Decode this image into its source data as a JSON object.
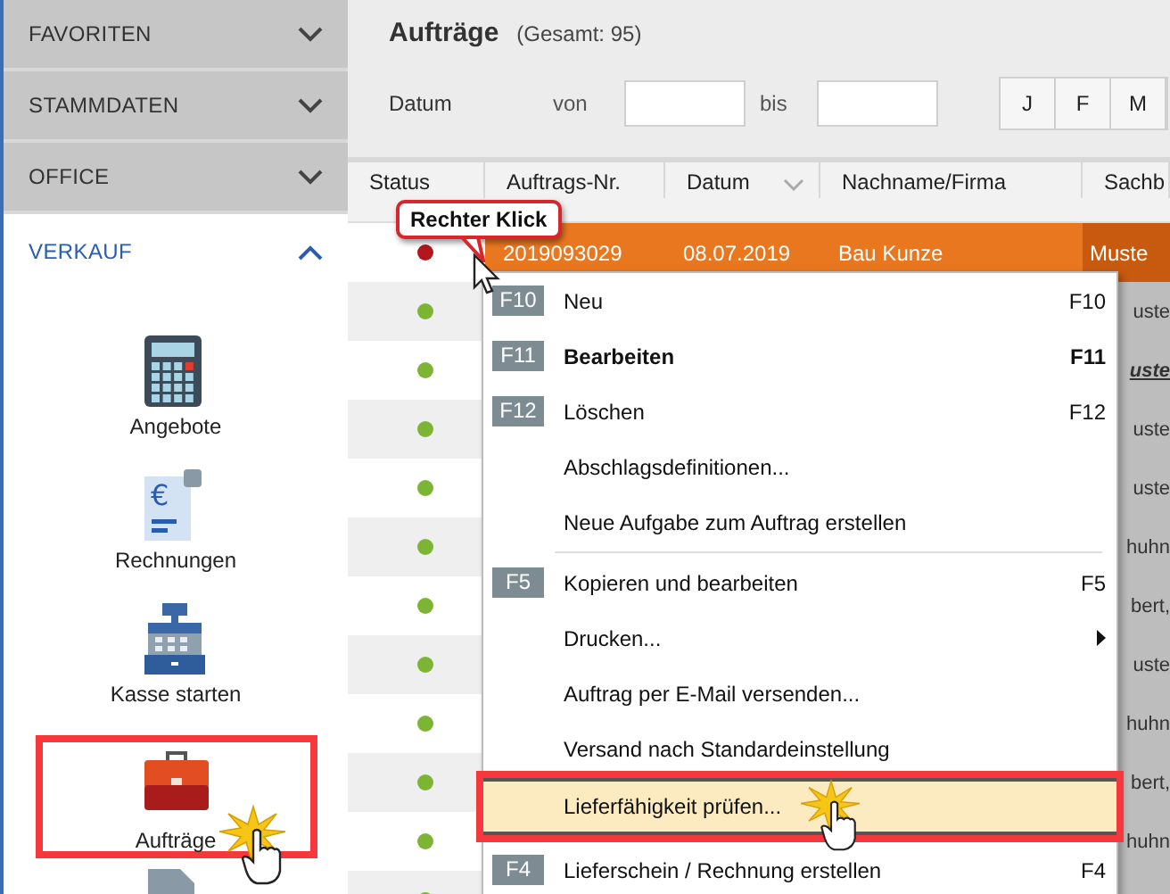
{
  "sidebar": {
    "sections": [
      {
        "label": "FAVORITEN",
        "expanded": false
      },
      {
        "label": "STAMMDATEN",
        "expanded": false
      },
      {
        "label": "OFFICE",
        "expanded": false
      },
      {
        "label": "VERKAUF",
        "expanded": true,
        "items": [
          {
            "kind": "calculator",
            "label": "Angebote",
            "highlighted": false
          },
          {
            "kind": "invoice",
            "glyph": "€",
            "label": "Rechnungen",
            "highlighted": false
          },
          {
            "kind": "register",
            "label": "Kasse starten",
            "highlighted": false
          },
          {
            "kind": "briefcase",
            "label": "Aufträge",
            "highlighted": true
          },
          {
            "kind": "document"
          }
        ]
      }
    ]
  },
  "main": {
    "title": "Aufträge",
    "total": "(Gesamt: 95)",
    "filter": {
      "label": "Datum",
      "from_label": "von",
      "to_label": "bis",
      "months": [
        "J",
        "F",
        "M"
      ]
    }
  },
  "table": {
    "columns": [
      {
        "label": "Status",
        "sorted": false
      },
      {
        "label": "Auftrags-Nr.",
        "sorted": false
      },
      {
        "label": "Datum",
        "sorted": true
      },
      {
        "label": "Nachname/Firma",
        "sorted": false
      },
      {
        "label": "Sachb",
        "sorted": false
      }
    ],
    "rows": [
      {
        "color": "#b3161c",
        "order_no": "2019093029",
        "date": "08.07.2019",
        "name": "Bau Kunze",
        "column_5": "Muste",
        "selected": true,
        "emphasized": false
      },
      {
        "color": "#7cb434",
        "column_5": "uste",
        "selected": false,
        "emphasized": false
      },
      {
        "color": "#7cb434",
        "column_5": "uste",
        "selected": false,
        "emphasized": true
      },
      {
        "color": "#7cb434",
        "column_5": "uste",
        "selected": false,
        "emphasized": false
      },
      {
        "color": "#7cb434",
        "column_5": "uste",
        "selected": false,
        "emphasized": false
      },
      {
        "color": "#7cb434",
        "column_5": "huhn",
        "selected": false,
        "emphasized": false
      },
      {
        "color": "#7cb434",
        "column_5": "bert,",
        "selected": false,
        "emphasized": false
      },
      {
        "color": "#7cb434",
        "column_5": "uste",
        "selected": false,
        "emphasized": false
      },
      {
        "color": "#7cb434",
        "column_5": "huhn",
        "selected": false,
        "emphasized": false
      },
      {
        "color": "#7cb434",
        "column_5": "bert,",
        "selected": false,
        "emphasized": false
      },
      {
        "color": "#7cb434",
        "column_5": "huhn",
        "selected": false,
        "emphasized": false
      },
      {
        "color": "#7cb434",
        "selected": false
      }
    ]
  },
  "context_menu": {
    "items": [
      {
        "kind": "item",
        "badge": "F10",
        "label": "Neu",
        "shortcut": "F10",
        "bold": false,
        "highlighted": false
      },
      {
        "kind": "item",
        "badge": "F11",
        "label": "Bearbeiten",
        "shortcut": "F11",
        "bold": true,
        "highlighted": false
      },
      {
        "kind": "item",
        "badge": "F12",
        "label": "Löschen",
        "shortcut": "F12",
        "bold": false,
        "highlighted": false
      },
      {
        "kind": "item",
        "label": "Abschlagsdefinitionen...",
        "bold": false,
        "highlighted": false
      },
      {
        "kind": "item",
        "label": "Neue Aufgabe zum Auftrag erstellen",
        "bold": false,
        "highlighted": false
      },
      {
        "kind": "separator"
      },
      {
        "kind": "item",
        "badge": "F5",
        "label": "Kopieren und bearbeiten",
        "shortcut": "F5",
        "bold": false,
        "highlighted": false
      },
      {
        "kind": "submenu",
        "label": "Drucken...",
        "bold": false,
        "highlighted": false
      },
      {
        "kind": "item",
        "label": "Auftrag per E-Mail versenden...",
        "bold": false,
        "highlighted": false
      },
      {
        "kind": "item",
        "label": "Versand nach Standardeinstellung",
        "bold": false,
        "highlighted": false
      },
      {
        "kind": "item",
        "label": "Lieferfähigkeit prüfen...",
        "bold": false,
        "highlighted": true
      },
      {
        "kind": "item",
        "badge": "F4",
        "label": "Lieferschein / Rechnung erstellen",
        "shortcut": "F4",
        "bold": false,
        "highlighted": false
      }
    ]
  },
  "callout": {
    "text": "Rechter Klick"
  }
}
